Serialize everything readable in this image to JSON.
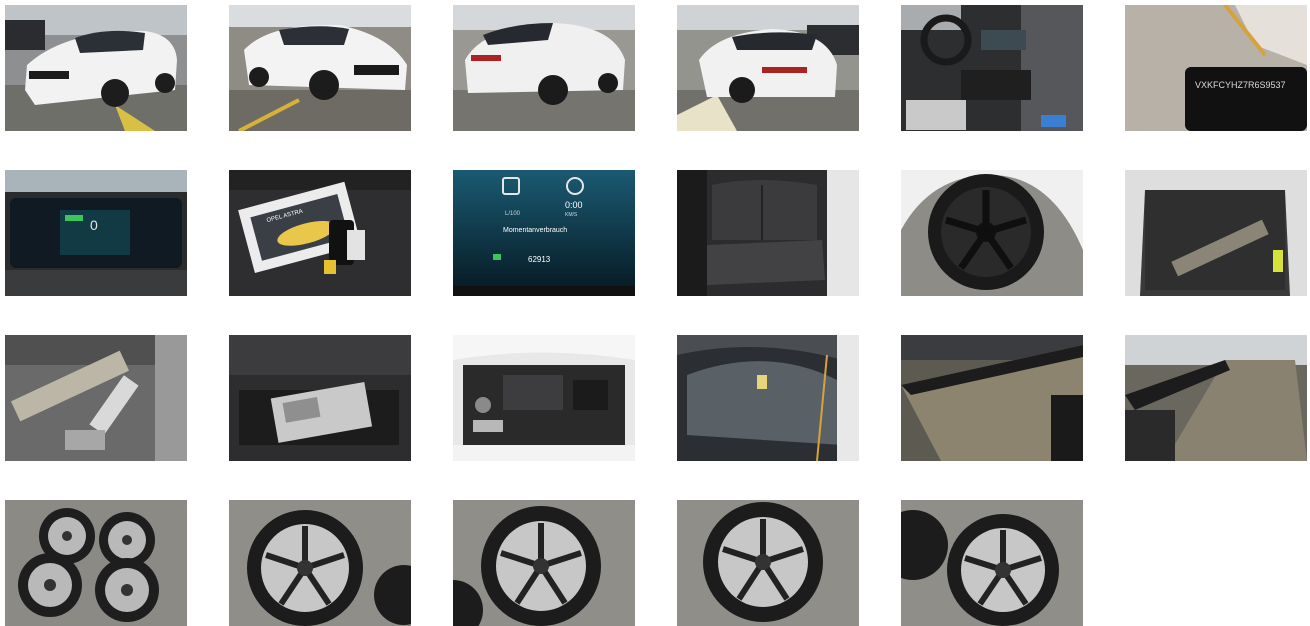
{
  "gallery": {
    "photos": [
      {
        "subject": "car-front-left"
      },
      {
        "subject": "car-front-right"
      },
      {
        "subject": "car-rear-left"
      },
      {
        "subject": "car-rear-right"
      },
      {
        "subject": "interior-cockpit"
      },
      {
        "subject": "vin-plate",
        "text": "VXKFCYHZ7R6S9537"
      },
      {
        "subject": "instrument-cluster"
      },
      {
        "subject": "owners-manual-and-keys",
        "text": "OPEL ASTRA"
      },
      {
        "subject": "consumption-display",
        "labels": {
          "unit": "L/100",
          "time": "0:00",
          "distance_unit": "KM/S",
          "title": "Momentanverbrauch",
          "odometer": "62913"
        }
      },
      {
        "subject": "rear-seats"
      },
      {
        "subject": "wheel-mounted"
      },
      {
        "subject": "trunk"
      },
      {
        "subject": "cargo-cover"
      },
      {
        "subject": "underfloor-compartment"
      },
      {
        "subject": "engine-bay"
      },
      {
        "subject": "windshield"
      },
      {
        "subject": "roof-left"
      },
      {
        "subject": "roof-right"
      },
      {
        "subject": "four-rims"
      },
      {
        "subject": "rim-1"
      },
      {
        "subject": "rim-2"
      },
      {
        "subject": "rim-3"
      },
      {
        "subject": "rim-4"
      }
    ]
  }
}
